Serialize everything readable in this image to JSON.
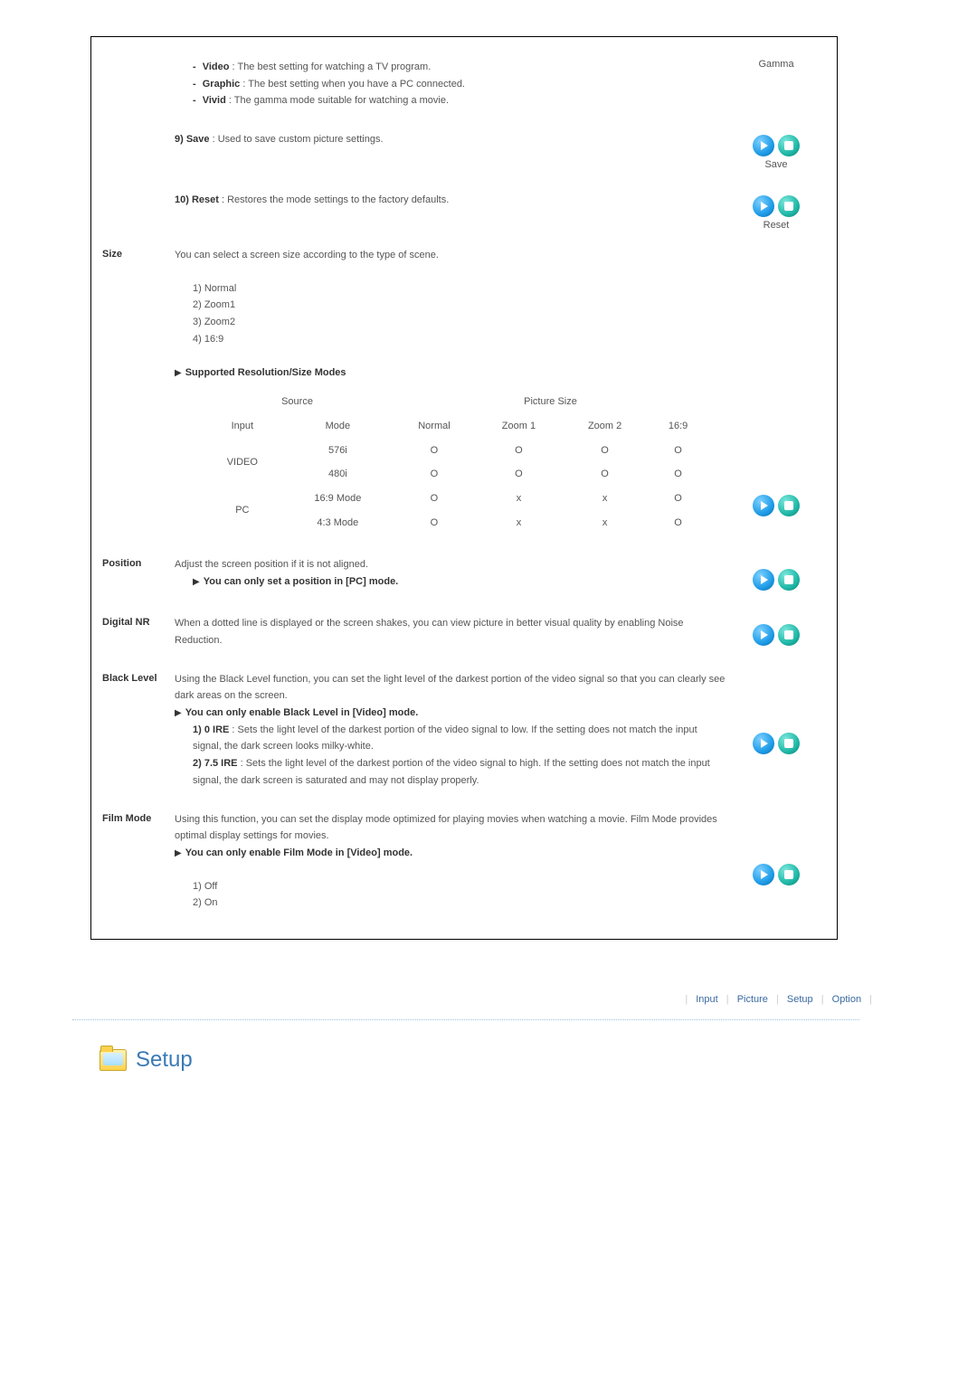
{
  "gamma": {
    "label": "Gamma",
    "video": {
      "term": "Video",
      "desc": " : The best setting for watching a TV program."
    },
    "graphic": {
      "term": "Graphic",
      "desc": " : The best setting when you have a PC connected."
    },
    "vivid": {
      "term": "Vivid",
      "desc": " : The gamma mode suitable for watching a movie."
    }
  },
  "save": {
    "label": "9) Save",
    "desc": " : Used to save custom picture settings.",
    "icon_caption": "Save"
  },
  "reset": {
    "label": "10) Reset",
    "desc": " : Restores the mode settings to the factory defaults.",
    "icon_caption": "Reset"
  },
  "size": {
    "title": "Size",
    "desc": "You can select a screen size according to the type of scene.",
    "items": [
      "1) Normal",
      "2) Zoom1",
      "3) Zoom2",
      "4) 16:9"
    ],
    "sub_header": "Supported Resolution/Size Modes",
    "table": {
      "h_source": "Source",
      "h_picture": "Picture Size",
      "h_input": "Input",
      "h_mode": "Mode",
      "h_normal": "Normal",
      "h_z1": "Zoom 1",
      "h_z2": "Zoom 2",
      "h_169": "16:9",
      "r1_input": "VIDEO",
      "r1_mode": "576i",
      "r1_n": "O",
      "r1_z1": "O",
      "r1_z2": "O",
      "r1_169": "O",
      "r2_mode": "480i",
      "r2_n": "O",
      "r2_z1": "O",
      "r2_z2": "O",
      "r2_169": "O",
      "r3_input": "PC",
      "r3_mode": "16:9 Mode",
      "r3_n": "O",
      "r3_z1": "x",
      "r3_z2": "x",
      "r3_169": "O",
      "r4_mode": "4:3 Mode",
      "r4_n": "O",
      "r4_z1": "x",
      "r4_z2": "x",
      "r4_169": "O"
    }
  },
  "position": {
    "title": "Position",
    "desc": "Adjust the screen position if it is not aligned.",
    "note": "You can only set a position in [PC] mode."
  },
  "digital_nr": {
    "title": "Digital NR",
    "desc": "When a dotted line is displayed or the screen shakes, you can view picture in better visual quality by enabling Noise Reduction."
  },
  "black_level": {
    "title": "Black Level",
    "desc": "Using the Black Level function, you can set the light level of the darkest portion of the video signal so that you can clearly see dark areas on the screen.",
    "note": "You can only enable Black Level in [Video] mode.",
    "ire0": {
      "label": "1) 0 IRE",
      "desc": " : Sets the light level of the darkest portion of the video signal to low. If the setting does not match the input signal, the dark screen looks milky-white."
    },
    "ire75": {
      "label": "2) 7.5 IRE",
      "desc": " : Sets the light level of the darkest portion of the video signal to high. If the setting does not match the input signal, the dark screen is saturated and may not display properly."
    }
  },
  "film_mode": {
    "title": "Film Mode",
    "desc": "Using this function, you can set the display mode optimized for playing movies when watching a movie. Film Mode provides optimal display settings for movies.",
    "note": "You can only enable Film Mode in [Video] mode.",
    "opt1": "1) Off",
    "opt2": "2) On"
  },
  "nav": {
    "input": "Input",
    "picture": "Picture",
    "setup": "Setup",
    "option": "Option"
  },
  "footer_header": "Setup"
}
